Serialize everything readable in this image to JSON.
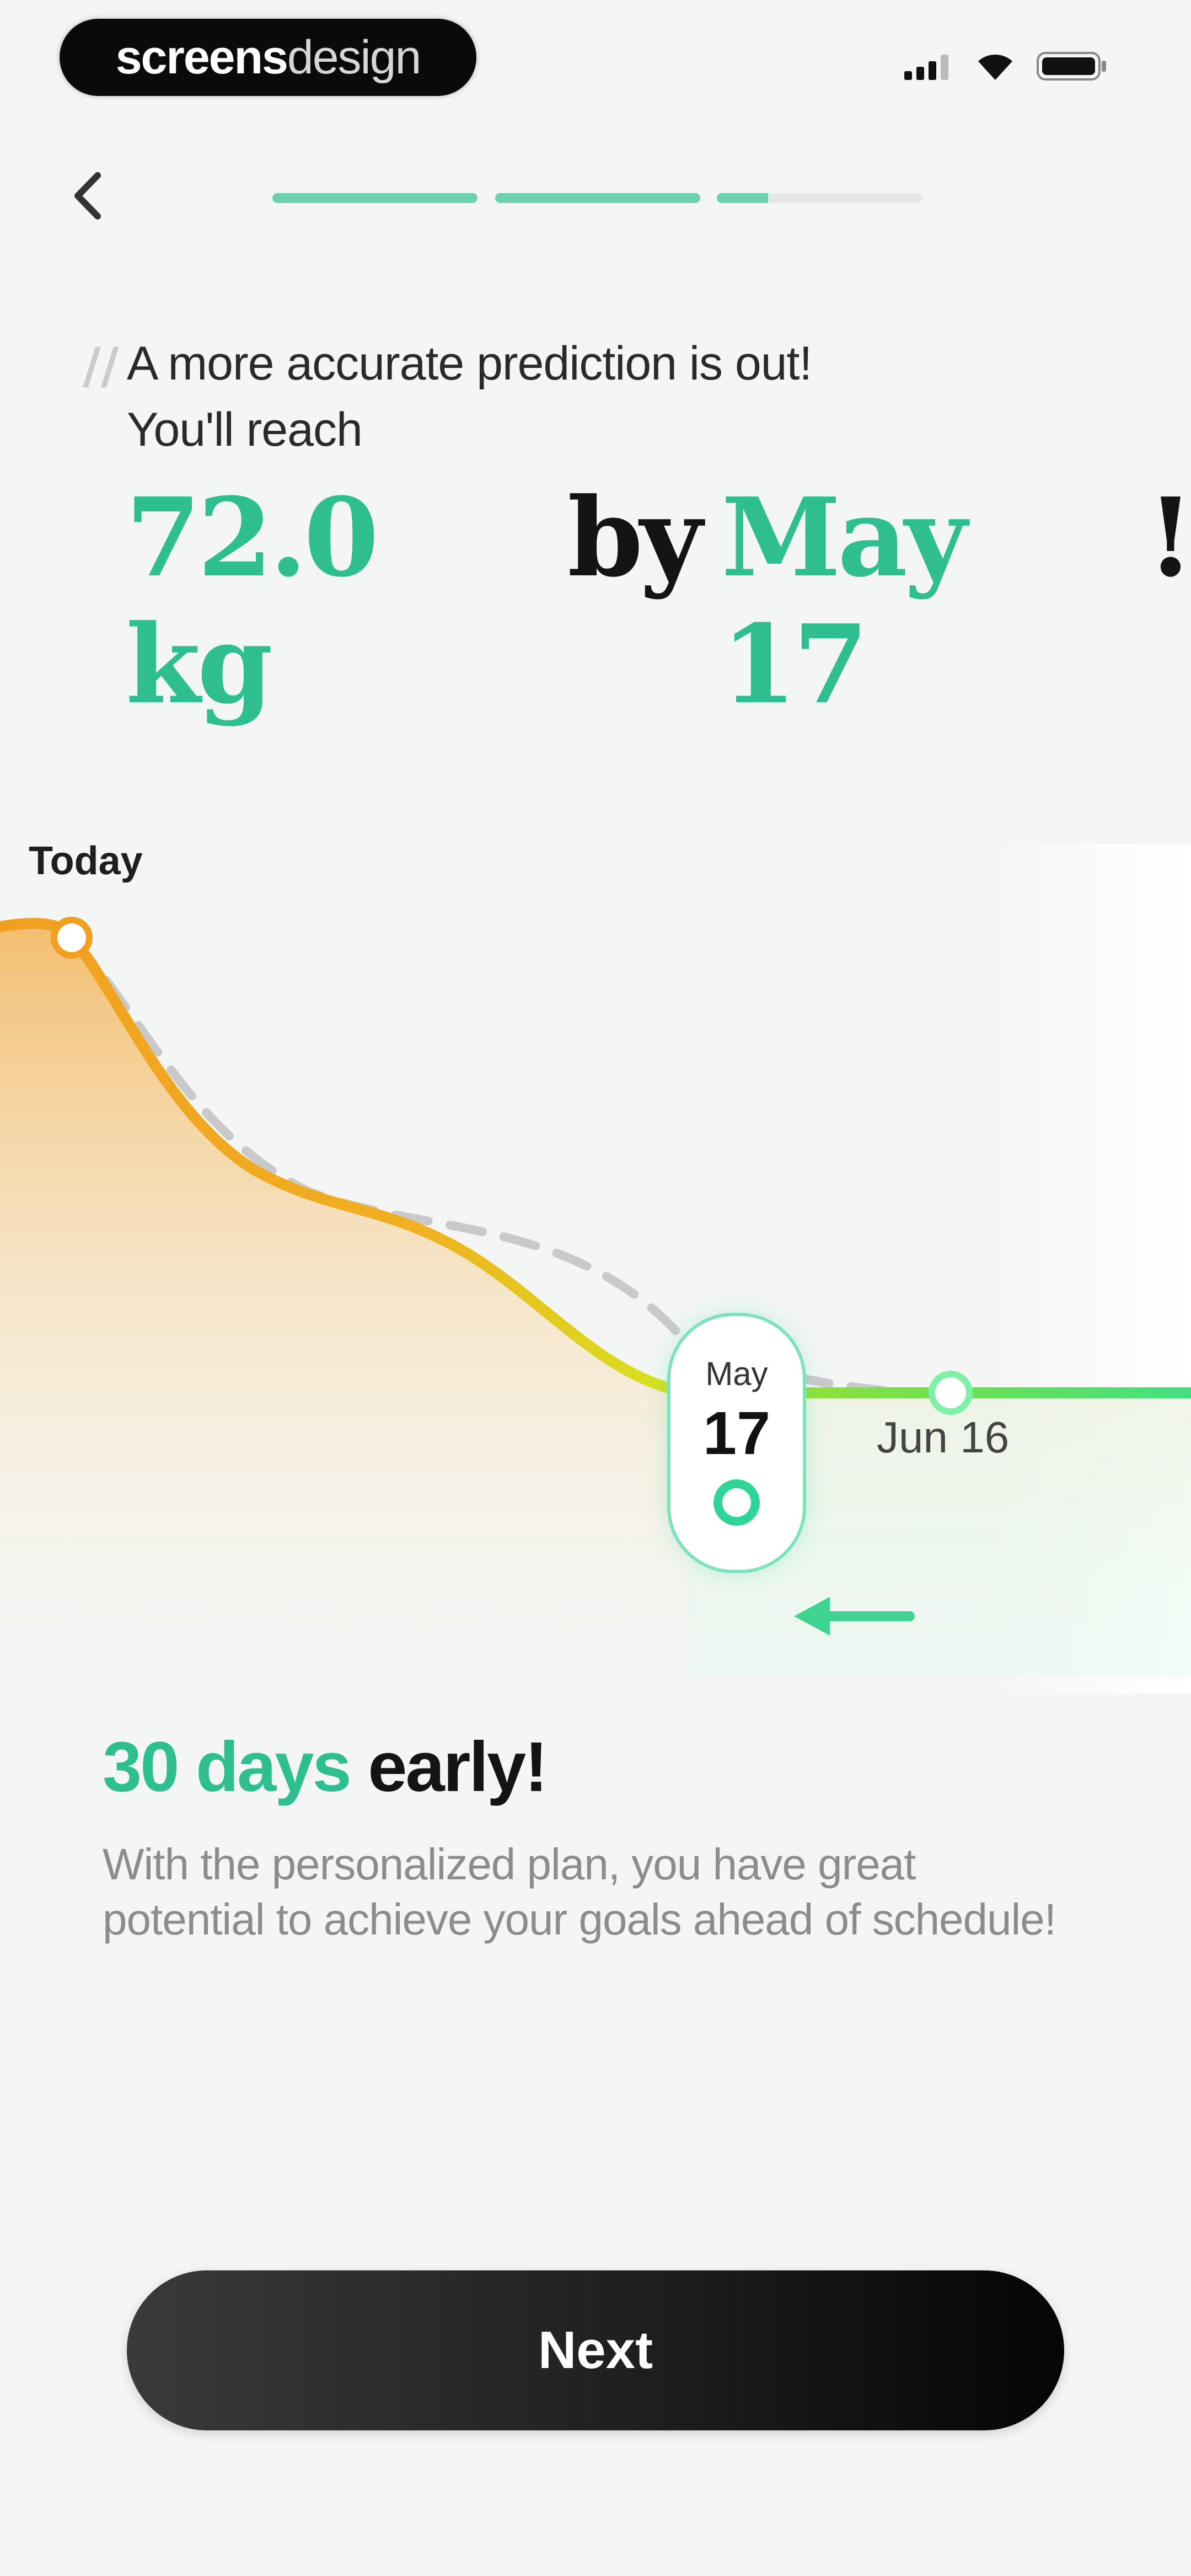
{
  "status_bar": {
    "brand_strong": "screens",
    "brand_light": "design",
    "icons": [
      "cellular-signal-icon",
      "wifi-icon",
      "battery-icon"
    ]
  },
  "nav": {
    "back_icon": "chevron-left-icon",
    "progress": {
      "segments": 4,
      "completed": 2,
      "current_fill": 0.25
    }
  },
  "headline": {
    "line1": "A more accurate prediction is out!",
    "line2": "You'll reach",
    "weight": "72.0 kg",
    "by": "by",
    "date": "May 17",
    "exclaim": "!"
  },
  "chart": {
    "today_label": "Today",
    "pill_month": "May",
    "pill_day": "17",
    "end_label": "Jun 16",
    "arrow_icon": "arrow-left-icon"
  },
  "result": {
    "highlight": "30 days",
    "rest": "early!",
    "description": "With the personalized plan, you have great potential to achieve your goals ahead of schedule!"
  },
  "cta": {
    "label": "Next"
  },
  "colors": {
    "accent_green": "#2fbe8f",
    "curve_orange": "#f0a020",
    "curve_yellow": "#d8e020",
    "curve_green": "#40e080",
    "button_dark": "#1c1c1c"
  }
}
